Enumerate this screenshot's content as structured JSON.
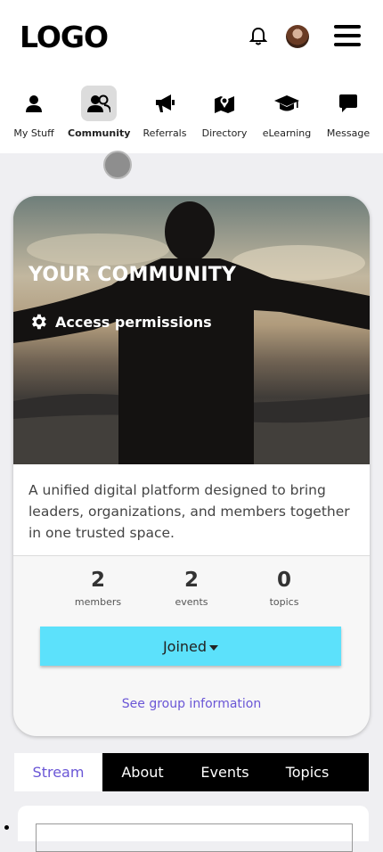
{
  "header": {
    "logo": "LOGO",
    "icons": [
      "bell-icon",
      "avatar",
      "hamburger-menu-icon"
    ]
  },
  "nav": {
    "items": [
      {
        "label": "My Stuff",
        "icon": "person-icon"
      },
      {
        "label": "Community",
        "icon": "people-icon",
        "active": true
      },
      {
        "label": "Referrals",
        "icon": "megaphone-icon"
      },
      {
        "label": "Directory",
        "icon": "map-icon"
      },
      {
        "label": "eLearning",
        "icon": "graduation-cap-icon"
      },
      {
        "label": "Message",
        "icon": "chat-bubble-icon"
      }
    ]
  },
  "community": {
    "title": "YOUR COMMUNITY",
    "access_label": "Access permissions",
    "description": "A unified digital platform designed to bring leaders, organizations, and members together in one trusted space.",
    "stats": [
      {
        "value": "2",
        "label": "members"
      },
      {
        "value": "2",
        "label": "events"
      },
      {
        "value": "0",
        "label": "topics"
      }
    ],
    "joined_label": "Joined",
    "see_info": "See group information"
  },
  "tabs": [
    {
      "label": "Stream",
      "active": true
    },
    {
      "label": "About"
    },
    {
      "label": "Events"
    },
    {
      "label": "Topics"
    }
  ],
  "colors": {
    "accent": "#6a56d6",
    "joined_button": "#5ce1fb",
    "tab_bar": "#000000"
  }
}
